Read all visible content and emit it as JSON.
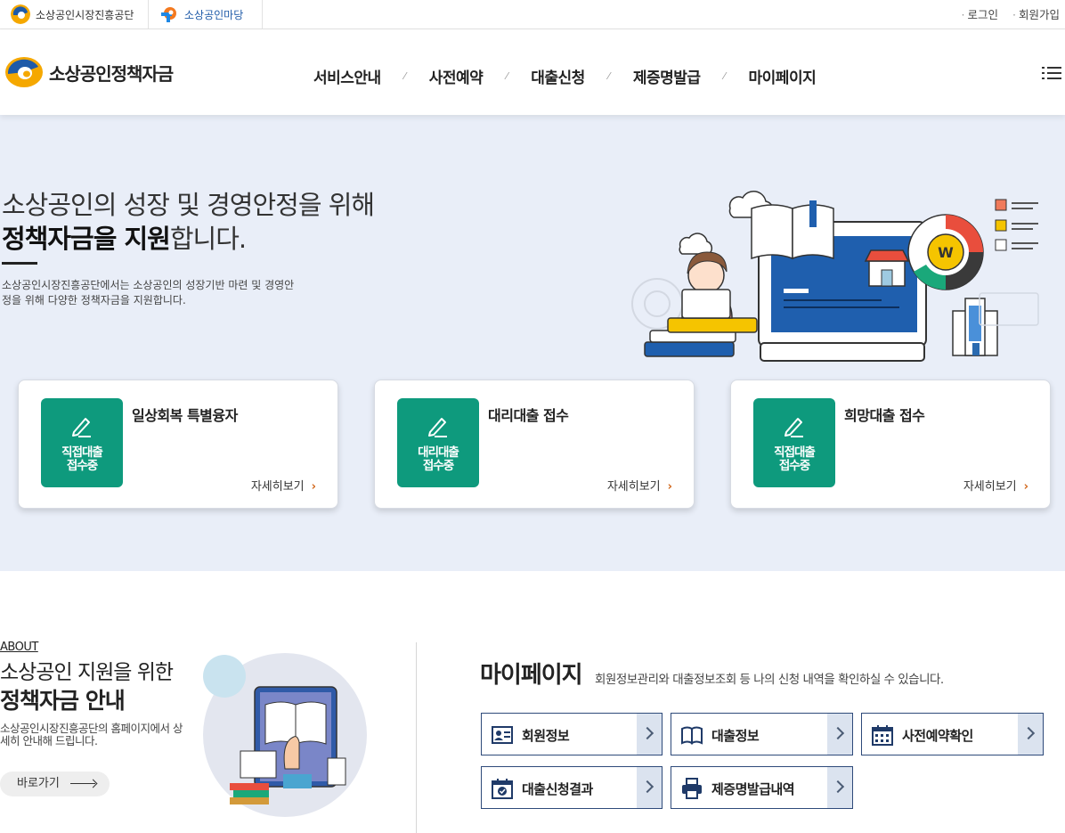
{
  "utilbar": {
    "site_tabs": [
      "소상공인시장진흥공단",
      "소상공인마당"
    ],
    "links": [
      "로그인",
      "회원가입"
    ]
  },
  "header": {
    "brand": "소상공인정책자금",
    "nav": [
      "서비스안내",
      "사전예약",
      "대출신청",
      "제증명발급",
      "마이페이지"
    ]
  },
  "hero": {
    "title_line1": "소상공인의 성장 및 경영안정을 위해",
    "title_line2_bold": "정책자금을 지원",
    "title_line2_rest": "합니다.",
    "description": "소상공인시장진흥공단에서는 소상공인의 성장기반 마련 및 경영안정을 위해 다양한 정책자금을 지원합니다."
  },
  "cards": [
    {
      "badge_line1": "직접대출",
      "badge_line2": "접수중",
      "title": "일상회복 특별융자",
      "more": "자세히보기"
    },
    {
      "badge_line1": "대리대출",
      "badge_line2": "접수중",
      "title": "대리대출 접수",
      "more": "자세히보기"
    },
    {
      "badge_line1": "직접대출",
      "badge_line2": "접수중",
      "title": "희망대출 접수",
      "more": "자세히보기"
    }
  ],
  "about": {
    "label": "ABOUT",
    "title_line1": "소상공인 지원을 위한",
    "title_line2": "정책자금 안내",
    "description": "소상공인시장진흥공단의 홈페이지에서 상세히 안내해 드립니다.",
    "button": "바로가기"
  },
  "mypage": {
    "title": "마이페이지",
    "description": "회원정보관리와 대출정보조회 등 나의 신청 내역을 확인하실 수 있습니다.",
    "buttons": [
      {
        "label": "회원정보",
        "icon": "id-card-icon"
      },
      {
        "label": "대출정보",
        "icon": "book-icon"
      },
      {
        "label": "사전예약확인",
        "icon": "calendar-grid-icon"
      },
      {
        "label": "대출신청결과",
        "icon": "calendar-check-icon"
      },
      {
        "label": "제증명발급내역",
        "icon": "printer-icon"
      }
    ]
  },
  "colors": {
    "hero_bg": "#e9eef8",
    "badge_green": "#0e9a7d",
    "navy_border": "#2e4a7a",
    "more_arrow": "#d2691e"
  }
}
